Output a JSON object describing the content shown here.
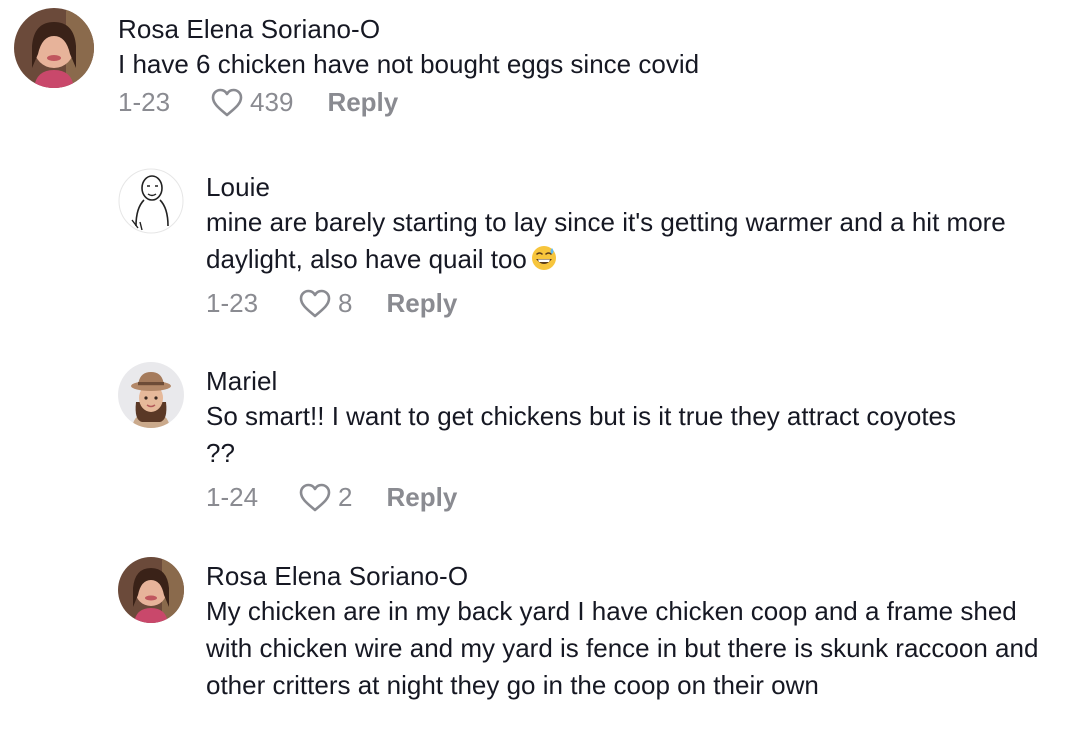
{
  "comments": [
    {
      "username": "Rosa Elena Soriano-O",
      "text": "I have 6 chicken have not bought eggs since covid",
      "date": "1-23",
      "likes": "439",
      "reply_label": "Reply"
    },
    {
      "username": "Louie",
      "text": "mine are barely starting to lay since it's getting warmer and a hit more daylight, also have quail too",
      "emoji": "grinning-sweat-emoji",
      "date": "1-23",
      "likes": "8",
      "reply_label": "Reply"
    },
    {
      "username": "Mariel",
      "text": "So smart!! I want to get chickens but is it true they attract coyotes ??",
      "date": "1-24",
      "likes": "2",
      "reply_label": "Reply"
    },
    {
      "username": "Rosa Elena Soriano-O",
      "text": "My chicken are in my back yard I have chicken coop and a frame shed with chicken wire and my yard is fence in but there is skunk raccoon and other critters at night they go in the coop on their own"
    }
  ],
  "colors": {
    "text": "#161823",
    "meta": "#8a8b91",
    "background": "#ffffff"
  }
}
